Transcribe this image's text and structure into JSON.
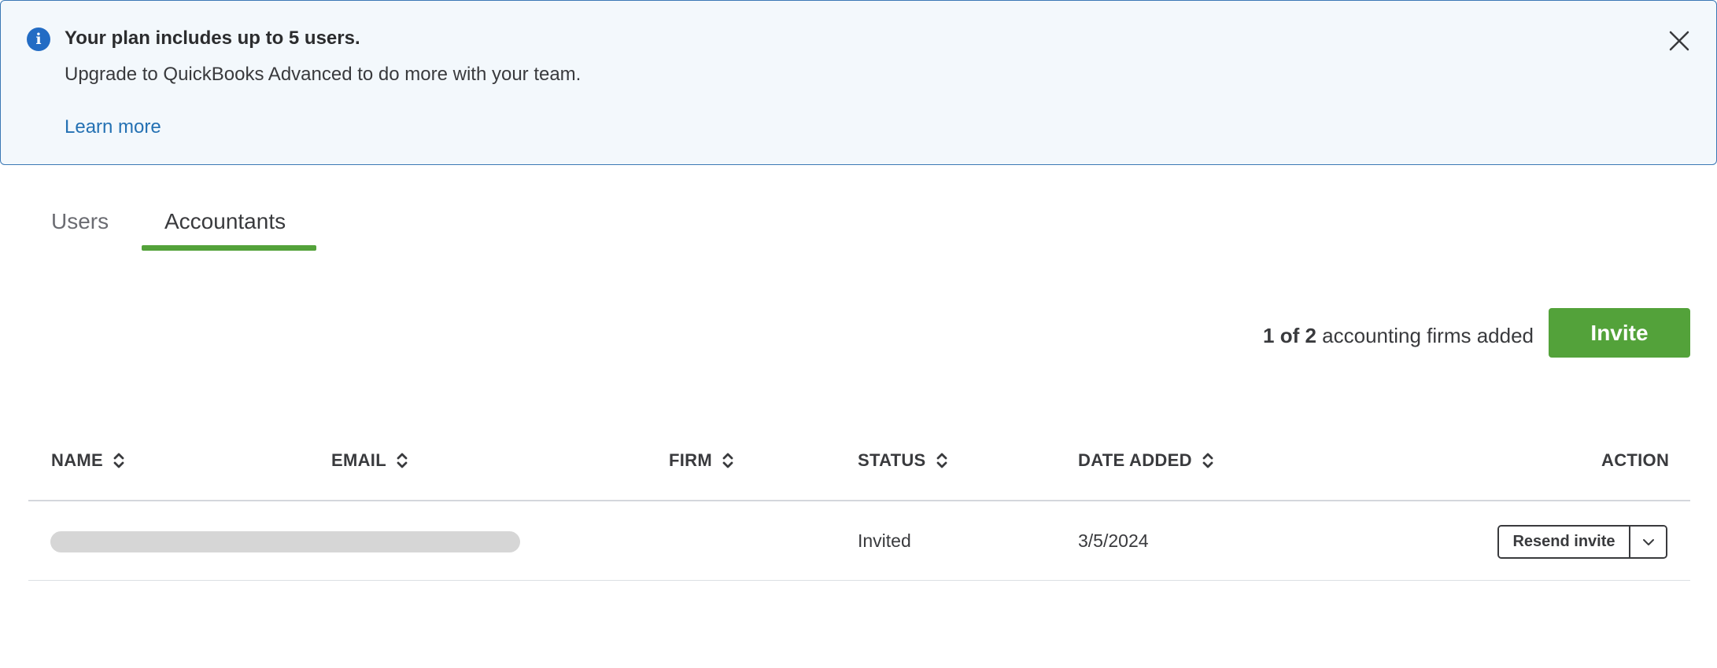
{
  "banner": {
    "title": "Your plan includes up to 5 users.",
    "text": "Upgrade to QuickBooks Advanced to do more with your team.",
    "link": "Learn more",
    "info_icon_glyph": "i",
    "info_icon": "info-icon",
    "close_icon": "close-icon"
  },
  "tabs": [
    {
      "label": "Users",
      "active": false
    },
    {
      "label": "Accountants",
      "active": true
    }
  ],
  "summary": {
    "count_bold": "1 of 2",
    "count_text": " accounting firms added",
    "invite_label": "Invite"
  },
  "table": {
    "columns": [
      {
        "label": "NAME",
        "sortable": true
      },
      {
        "label": "EMAIL",
        "sortable": true
      },
      {
        "label": "FIRM",
        "sortable": true
      },
      {
        "label": "STATUS",
        "sortable": true
      },
      {
        "label": "DATE ADDED",
        "sortable": true
      },
      {
        "label": "ACTION",
        "sortable": false
      }
    ],
    "rows": [
      {
        "name": "",
        "email": "",
        "firm": "",
        "status": "Invited",
        "date_added": "3/5/2024",
        "action_label": "Resend invite"
      }
    ]
  },
  "colors": {
    "accent_green": "#53a23a",
    "link_blue": "#2471b3",
    "banner_border": "#3b78b5",
    "info_blue": "#236cc4"
  }
}
